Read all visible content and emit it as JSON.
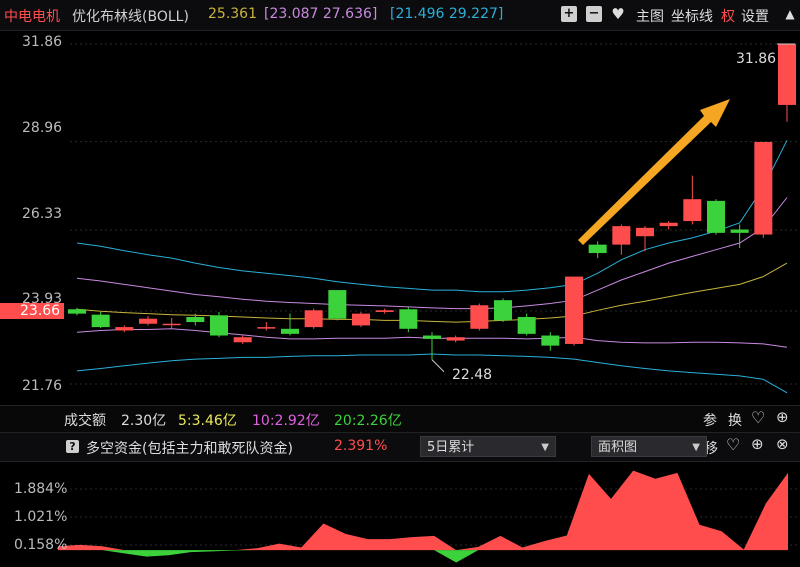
{
  "header": {
    "stock_name": "中电电机",
    "indicator": "优化布林线(BOLL)",
    "mid_value": "25.361",
    "upper_range": "[23.087 27.636]",
    "lower_range": "[21.496 29.227]",
    "plus_icon": "plus-square-icon",
    "minus_icon": "minus-square-icon",
    "heart_icon": "heart-icon",
    "main_chart": "主图",
    "coord_line": "坐标线",
    "quan": "权",
    "settings": "设置"
  },
  "price_axis": {
    "ticks": [
      "31.86",
      "28.96",
      "26.33",
      "23.93",
      "21.76"
    ],
    "current_price_tag": "23.66",
    "high_annotation": "31.86",
    "low_annotation": "22.48"
  },
  "volume_bar": {
    "label": "成交额",
    "value": "2.30亿",
    "ma5": "5:3.46亿",
    "ma10": "10:2.92亿",
    "ma20": "20:2.26亿",
    "btn_can": "参",
    "btn_huan": "换"
  },
  "fund_bar": {
    "help": "?",
    "title": "多空资金(包括主力和敢死队资金)",
    "value": "2.391%",
    "period_selected": "5日累计",
    "chart_type_selected": "面积图",
    "btn_yi": "移"
  },
  "fund_axis": {
    "ticks": [
      "1.884%",
      "1.021%",
      "0.158%"
    ]
  },
  "colors": {
    "up": "#ff4d4d",
    "down": "#3cd23c",
    "upper_band": "#2ab0d8",
    "mid_band": "#c98ae0",
    "ma_yellow": "#c8b43c",
    "arrow": "#f5a623"
  },
  "chart_data": [
    {
      "type": "candlestick",
      "title": "优化布林线(BOLL)",
      "ylim": [
        21.4,
        32.2
      ],
      "candles": [
        {
          "o": 23.98,
          "c": 23.85,
          "h": 24.02,
          "l": 23.8
        },
        {
          "o": 23.82,
          "c": 23.45,
          "h": 23.9,
          "l": 23.42
        },
        {
          "o": 23.35,
          "c": 23.45,
          "h": 23.5,
          "l": 23.3
        },
        {
          "o": 23.55,
          "c": 23.7,
          "h": 23.78,
          "l": 23.5
        },
        {
          "o": 23.55,
          "c": 23.55,
          "h": 23.72,
          "l": 23.4
        },
        {
          "o": 23.75,
          "c": 23.6,
          "h": 23.85,
          "l": 23.5
        },
        {
          "o": 23.8,
          "c": 23.2,
          "h": 23.9,
          "l": 23.15
        },
        {
          "o": 23.0,
          "c": 23.15,
          "h": 23.2,
          "l": 22.95
        },
        {
          "o": 23.45,
          "c": 23.45,
          "h": 23.6,
          "l": 23.35
        },
        {
          "o": 23.4,
          "c": 23.25,
          "h": 23.85,
          "l": 23.2
        },
        {
          "o": 23.45,
          "c": 23.95,
          "h": 24.0,
          "l": 23.4
        },
        {
          "o": 24.55,
          "c": 23.7,
          "h": 24.55,
          "l": 23.65
        },
        {
          "o": 23.5,
          "c": 23.85,
          "h": 23.9,
          "l": 23.45
        },
        {
          "o": 23.9,
          "c": 23.95,
          "h": 24.0,
          "l": 23.85
        },
        {
          "o": 23.98,
          "c": 23.4,
          "h": 24.05,
          "l": 23.3
        },
        {
          "o": 23.2,
          "c": 23.1,
          "h": 23.3,
          "l": 22.48
        },
        {
          "o": 23.05,
          "c": 23.15,
          "h": 23.2,
          "l": 23.0
        },
        {
          "o": 23.4,
          "c": 24.1,
          "h": 24.15,
          "l": 23.35
        },
        {
          "o": 24.25,
          "c": 23.65,
          "h": 24.3,
          "l": 23.6
        },
        {
          "o": 23.75,
          "c": 23.25,
          "h": 23.85,
          "l": 23.2
        },
        {
          "o": 23.2,
          "c": 22.9,
          "h": 23.3,
          "l": 22.75
        },
        {
          "o": 22.95,
          "c": 24.95,
          "h": 24.95,
          "l": 22.9
        },
        {
          "o": 25.9,
          "c": 25.65,
          "h": 26.0,
          "l": 25.5
        },
        {
          "o": 25.9,
          "c": 26.45,
          "h": 26.5,
          "l": 25.6
        },
        {
          "o": 26.15,
          "c": 26.4,
          "h": 26.45,
          "l": 25.7
        },
        {
          "o": 26.45,
          "c": 26.55,
          "h": 26.6,
          "l": 26.35
        },
        {
          "o": 26.6,
          "c": 27.25,
          "h": 27.95,
          "l": 26.5
        },
        {
          "o": 27.2,
          "c": 26.25,
          "h": 27.25,
          "l": 26.2
        },
        {
          "o": 26.35,
          "c": 26.25,
          "h": 26.5,
          "l": 25.8
        },
        {
          "o": 26.2,
          "c": 28.95,
          "h": 28.95,
          "l": 26.1
        },
        {
          "o": 30.05,
          "c": 31.86,
          "h": 31.86,
          "l": 29.55
        }
      ],
      "upper": [
        25.95,
        25.85,
        25.72,
        25.6,
        25.5,
        25.35,
        25.22,
        25.12,
        25.05,
        24.98,
        24.9,
        24.8,
        24.72,
        24.65,
        24.6,
        24.55,
        24.55,
        24.5,
        24.5,
        24.55,
        24.62,
        24.72,
        25.05,
        25.45,
        25.75,
        25.95,
        26.1,
        26.3,
        26.55,
        27.6,
        29.0
      ],
      "mid": [
        24.9,
        24.82,
        24.72,
        24.62,
        24.52,
        24.42,
        24.35,
        24.28,
        24.22,
        24.18,
        24.15,
        24.12,
        24.1,
        24.08,
        24.05,
        24.02,
        24.0,
        24.0,
        24.02,
        24.08,
        24.15,
        24.25,
        24.55,
        24.85,
        25.1,
        25.35,
        25.55,
        25.75,
        25.95,
        26.4,
        27.3
      ],
      "ma": [
        23.98,
        23.92,
        23.88,
        23.85,
        23.82,
        23.8,
        23.78,
        23.75,
        23.72,
        23.7,
        23.7,
        23.68,
        23.68,
        23.65,
        23.65,
        23.62,
        23.6,
        23.62,
        23.65,
        23.68,
        23.72,
        23.78,
        23.95,
        24.1,
        24.22,
        24.35,
        24.48,
        24.6,
        24.72,
        24.95,
        25.35
      ],
      "lower": [
        23.3,
        23.35,
        23.38,
        23.38,
        23.4,
        23.35,
        23.28,
        23.22,
        23.15,
        23.1,
        23.1,
        23.12,
        23.12,
        23.12,
        23.15,
        23.12,
        23.12,
        23.12,
        23.12,
        23.1,
        23.12,
        23.15,
        23.05,
        23.0,
        22.98,
        22.98,
        23.0,
        23.0,
        22.98,
        22.95,
        22.85
      ],
      "bottom": [
        22.15,
        22.22,
        22.3,
        22.38,
        22.45,
        22.5,
        22.52,
        22.55,
        22.55,
        22.58,
        22.6,
        22.6,
        22.62,
        22.62,
        22.62,
        22.65,
        22.62,
        22.62,
        22.6,
        22.58,
        22.55,
        22.5,
        22.4,
        22.3,
        22.22,
        22.15,
        22.1,
        22.05,
        22.0,
        21.9,
        21.5
      ]
    },
    {
      "type": "area",
      "title": "多空资金(包括主力和敢死队资金)",
      "ylim": [
        -0.4,
        2.5
      ],
      "values": [
        0.12,
        0.16,
        0.12,
        -0.1,
        -0.2,
        -0.16,
        -0.06,
        -0.04,
        -0.01,
        0.06,
        0.2,
        0.08,
        0.82,
        0.5,
        0.34,
        0.34,
        0.4,
        0.44,
        -0.38,
        0.1,
        0.44,
        0.08,
        0.28,
        0.45,
        2.35,
        1.58,
        2.45,
        2.2,
        2.38,
        0.78,
        0.58,
        0.02,
        1.44,
        2.38
      ]
    }
  ]
}
